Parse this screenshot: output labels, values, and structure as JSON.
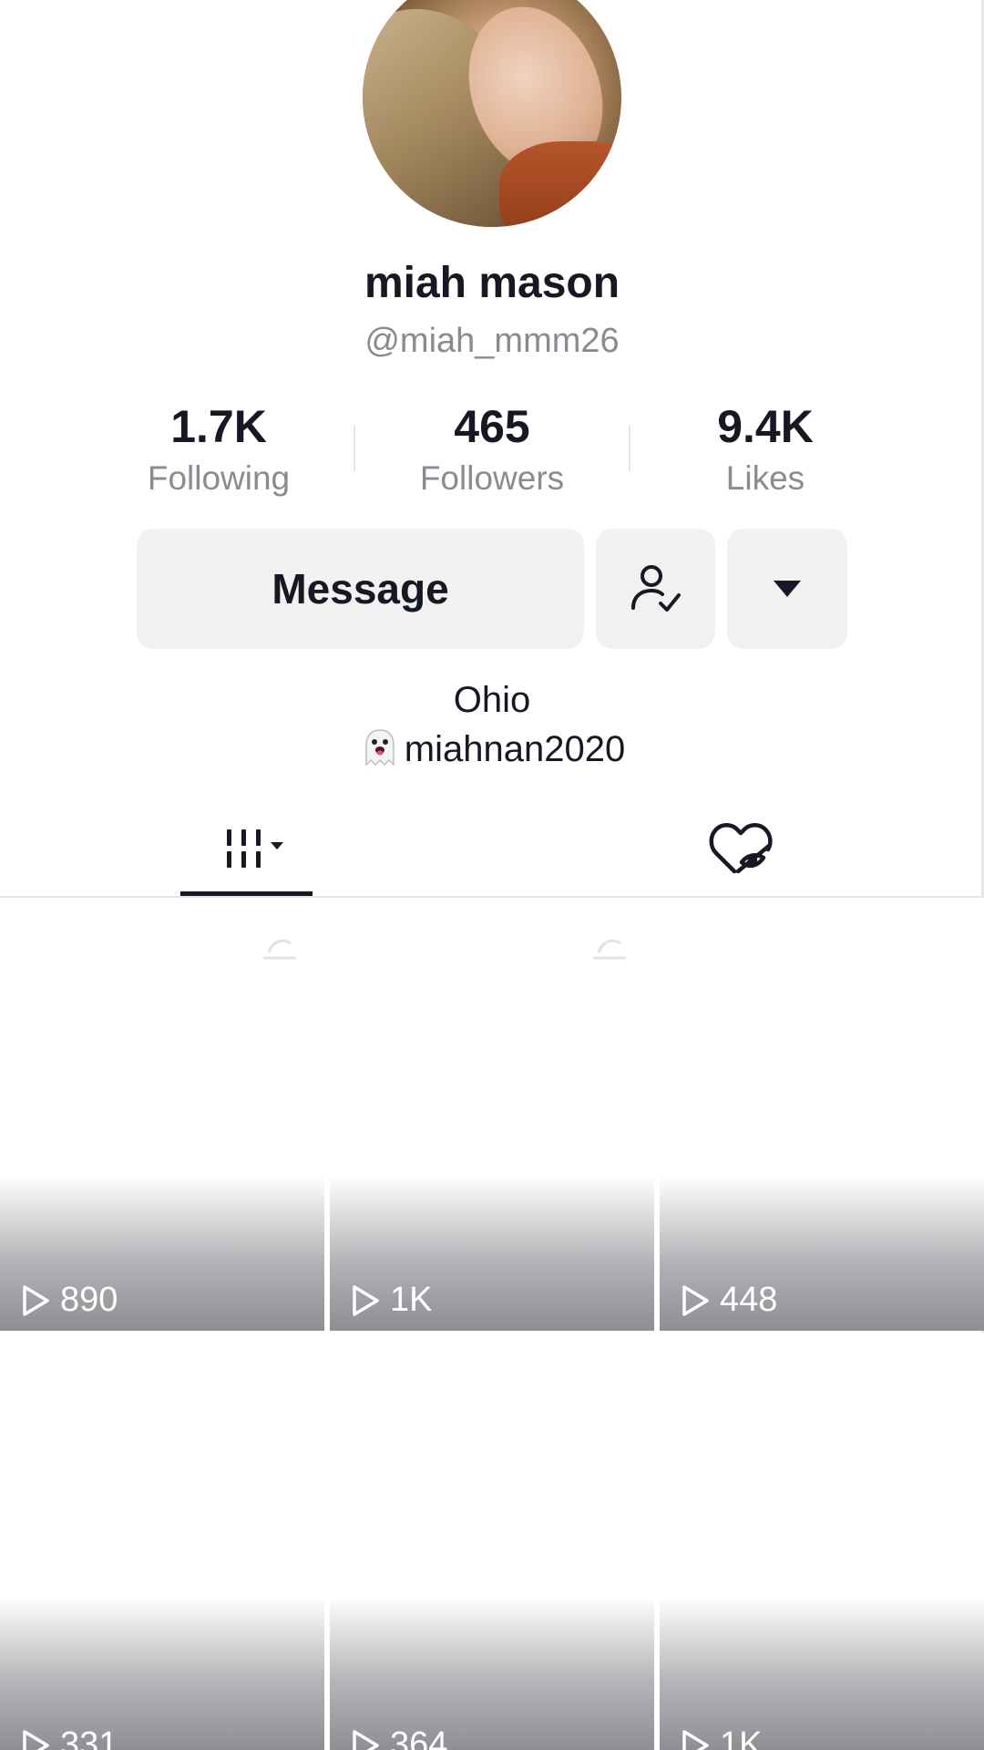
{
  "profile": {
    "display_name": "miah mason",
    "username": "@miah_mmm26",
    "avatar": "profile-photo"
  },
  "stats": [
    {
      "value": "1.7K",
      "label": "Following"
    },
    {
      "value": "465",
      "label": "Followers"
    },
    {
      "value": "9.4K",
      "label": "Likes"
    }
  ],
  "actions": {
    "message_label": "Message",
    "user_icon": "user-check-icon",
    "more_icon": "caret-down-icon"
  },
  "bio": {
    "location": "Ohio",
    "snapchat_emoji": "ghost-emoji",
    "snapchat": "miahnan2020"
  },
  "tabs": [
    {
      "icon": "videos-grid-icon",
      "active": true
    },
    {
      "icon": "liked-hidden-icon",
      "active": false
    }
  ],
  "videos": [
    {
      "views": "890"
    },
    {
      "views": "1K"
    },
    {
      "views": "448"
    },
    {
      "views": "331"
    },
    {
      "views": "364"
    },
    {
      "views": "1K"
    }
  ],
  "colors": {
    "text": "#161823",
    "muted": "#8a8b91",
    "button_bg": "#f1f1f2",
    "divider": "#e6e6e6"
  }
}
